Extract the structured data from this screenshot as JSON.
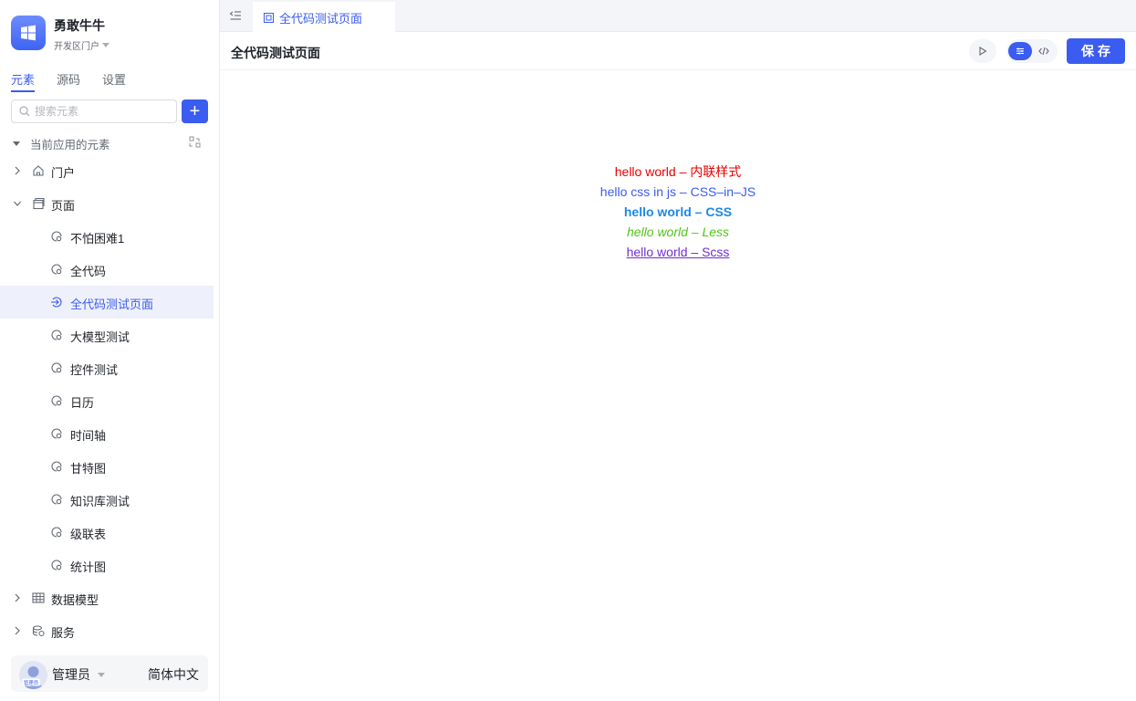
{
  "app": {
    "name": "勇敢牛牛",
    "portal": "开发区门户"
  },
  "tabs": [
    "元素",
    "源码",
    "设置"
  ],
  "search": {
    "placeholder": "搜索元素"
  },
  "tree": {
    "header": "当前应用的元素",
    "nodes": [
      {
        "label": "门户",
        "icon": "home-icon",
        "expanded": false
      },
      {
        "label": "页面",
        "icon": "pages-icon",
        "expanded": true,
        "children": [
          "不怕困难1",
          "全代码",
          "全代码测试页面",
          "大模型测试",
          "控件测试",
          "日历",
          "时间轴",
          "甘特图",
          "知识库测试",
          "级联表",
          "统计图"
        ]
      },
      {
        "label": "数据模型",
        "icon": "table-icon",
        "expanded": false
      },
      {
        "label": "服务",
        "icon": "service-icon",
        "expanded": false
      }
    ],
    "selected": "全代码测试页面"
  },
  "footer": {
    "avatar_tag": "管理员",
    "user": "管理员",
    "language": "简体中文"
  },
  "open_tab": {
    "label": "全代码测试页面"
  },
  "page": {
    "title": "全代码测试页面",
    "save_label": "保存"
  },
  "canvas": {
    "lines": [
      "hello world – 内联样式",
      "hello css in js – CSS–in–JS",
      "hello world – CSS",
      "hello world – Less",
      "hello world – Scss"
    ]
  },
  "colors": {
    "accent": "#3b5cf0",
    "inline": "#e60000",
    "css_in_js": "#3b5cf0",
    "css": "#1e88e5",
    "less": "#52c41a",
    "scss": "#722ed1"
  }
}
